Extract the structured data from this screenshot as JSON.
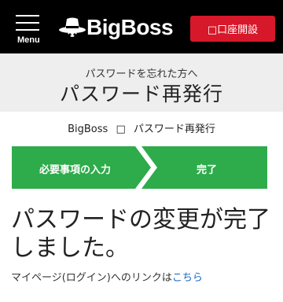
{
  "header": {
    "menu_label": "Menu",
    "logo_text": "BigBoss",
    "account_button": "□口座開設"
  },
  "title_band": {
    "subtitle": "パスワードを忘れた方へ",
    "title": "パスワード再発行"
  },
  "breadcrumb": {
    "home": "BigBoss",
    "separator": "□",
    "current": "パスワード再発行"
  },
  "steps": [
    {
      "label": "必要事項の入力"
    },
    {
      "label": "完了"
    }
  ],
  "steps_color": "#2eab4a",
  "message": "パスワードの変更が完了しました。",
  "mypage": {
    "text": "マイページ(ログイン)へのリンクは",
    "link": "こちら"
  },
  "colors": {
    "header_bg": "#000000",
    "account_button": "#d7182a",
    "link": "#1a66c4"
  }
}
